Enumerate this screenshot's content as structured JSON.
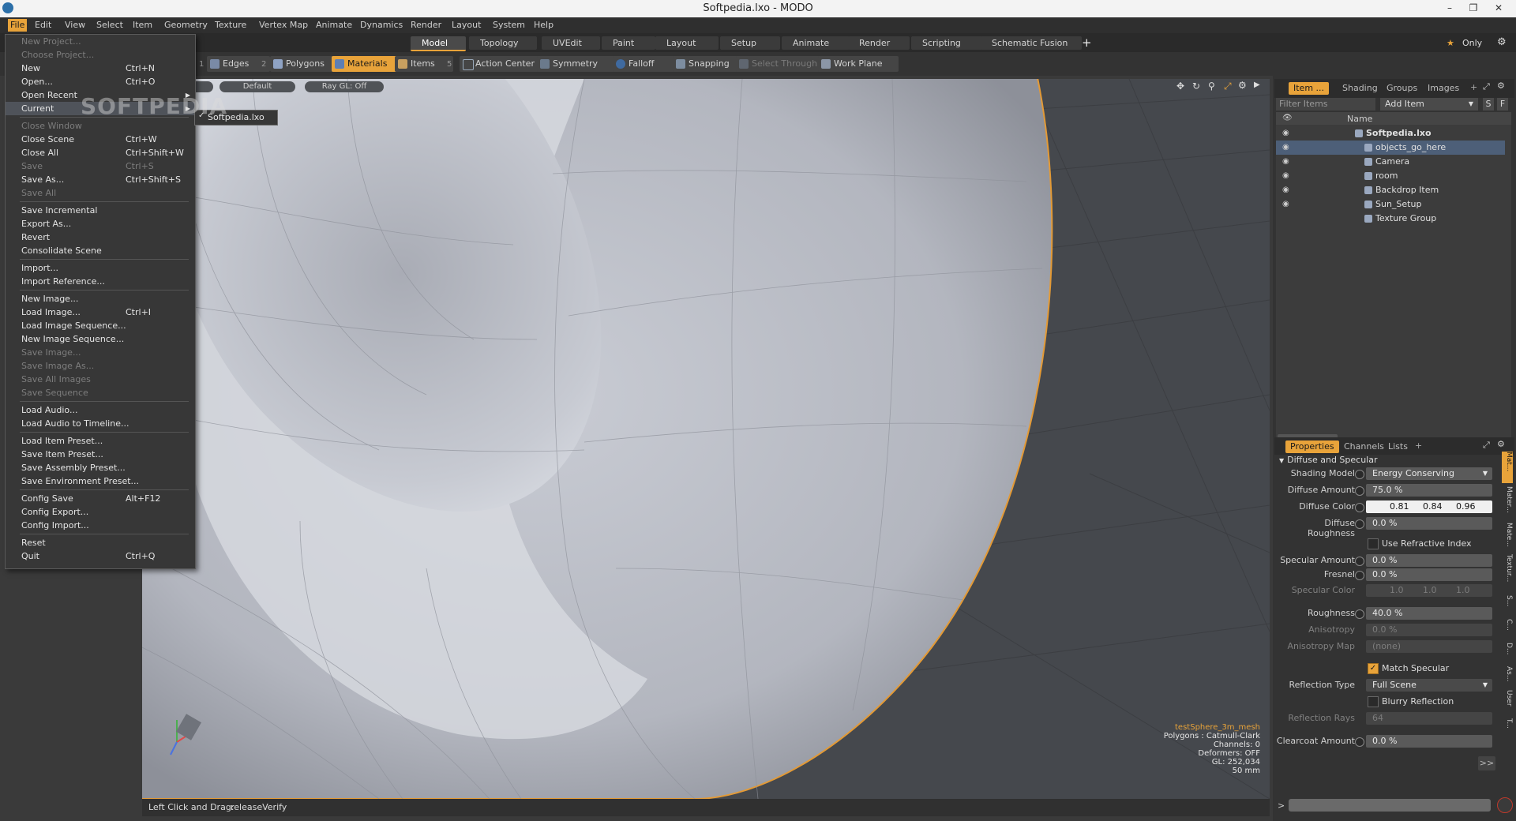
{
  "window": {
    "title": "Softpedia.lxo - MODO"
  },
  "menubar": [
    "File",
    "Edit",
    "View",
    "Select",
    "Item",
    "Geometry",
    "Texture",
    "Vertex Map",
    "Animate",
    "Dynamics",
    "Render",
    "Layout",
    "System",
    "Help"
  ],
  "layout_tabs": [
    "Model",
    "Topology",
    "UVEdit",
    "Paint",
    "Layout",
    "Setup",
    "Animate",
    "Render",
    "Scripting",
    "Schematic Fusion"
  ],
  "only_label": "Only",
  "toolbar": {
    "edges": "Edges",
    "polygons": "Polygons",
    "materials": "Materials",
    "items": "Items",
    "num1": "1",
    "num2": "2",
    "num5": "5",
    "action_center": "Action Center",
    "symmetry": "Symmetry",
    "falloff": "Falloff",
    "snapping": "Snapping",
    "select_through": "Select Through",
    "work_plane": "Work Plane"
  },
  "viewport": {
    "chip1": "ive",
    "chip2": "Default",
    "chip3": "Ray GL: Off",
    "hud": {
      "mesh": "testSphere_3m_mesh",
      "polygons": "Polygons : Catmull-Clark",
      "channels": "Channels: 0",
      "deformers": "Deformers: OFF",
      "gl": "GL: 252,034",
      "mm": "50 mm"
    },
    "status_action": "Left Click and Drag:",
    "status_value": "releaseVerify"
  },
  "file_menu": {
    "items": [
      {
        "label": "New Project...",
        "shortcut": "",
        "disabled": true
      },
      {
        "label": "Choose Project...",
        "shortcut": "",
        "disabled": true
      },
      {
        "label": "New",
        "shortcut": "Ctrl+N",
        "disabled": false
      },
      {
        "label": "Open...",
        "shortcut": "Ctrl+O",
        "disabled": false
      },
      {
        "label": "Open Recent",
        "shortcut": "",
        "disabled": false
      },
      {
        "label": "Current",
        "shortcut": "",
        "disabled": false
      },
      {
        "label": "Close Window",
        "shortcut": "",
        "disabled": true
      },
      {
        "label": "Close Scene",
        "shortcut": "Ctrl+W",
        "disabled": false
      },
      {
        "label": "Close All",
        "shortcut": "Ctrl+Shift+W",
        "disabled": false
      },
      {
        "label": "Save",
        "shortcut": "Ctrl+S",
        "disabled": true
      },
      {
        "label": "Save As...",
        "shortcut": "Ctrl+Shift+S",
        "disabled": false
      },
      {
        "label": "Save All",
        "shortcut": "",
        "disabled": true
      },
      {
        "label": "Save Incremental",
        "shortcut": "",
        "disabled": false
      },
      {
        "label": "Export As...",
        "shortcut": "",
        "disabled": false
      },
      {
        "label": "Revert",
        "shortcut": "",
        "disabled": false
      },
      {
        "label": "Consolidate Scene",
        "shortcut": "",
        "disabled": false
      },
      {
        "label": "Import...",
        "shortcut": "",
        "disabled": false
      },
      {
        "label": "Import Reference...",
        "shortcut": "",
        "disabled": false
      },
      {
        "label": "New Image...",
        "shortcut": "",
        "disabled": false
      },
      {
        "label": "Load Image...",
        "shortcut": "Ctrl+I",
        "disabled": false
      },
      {
        "label": "Load Image Sequence...",
        "shortcut": "",
        "disabled": false
      },
      {
        "label": "New Image Sequence...",
        "shortcut": "",
        "disabled": false
      },
      {
        "label": "Save Image...",
        "shortcut": "",
        "disabled": true
      },
      {
        "label": "Save Image As...",
        "shortcut": "",
        "disabled": true
      },
      {
        "label": "Save All Images",
        "shortcut": "",
        "disabled": true
      },
      {
        "label": "Save Sequence",
        "shortcut": "",
        "disabled": true
      },
      {
        "label": "Load Audio...",
        "shortcut": "",
        "disabled": false
      },
      {
        "label": "Load Audio to Timeline...",
        "shortcut": "",
        "disabled": false
      },
      {
        "label": "Load Item Preset...",
        "shortcut": "",
        "disabled": false
      },
      {
        "label": "Save Item Preset...",
        "shortcut": "",
        "disabled": false
      },
      {
        "label": "Save Assembly Preset...",
        "shortcut": "",
        "disabled": false
      },
      {
        "label": "Save Environment Preset...",
        "shortcut": "",
        "disabled": false
      },
      {
        "label": "Config Save",
        "shortcut": "Alt+F12",
        "disabled": false
      },
      {
        "label": "Config Export...",
        "shortcut": "",
        "disabled": false
      },
      {
        "label": "Config Import...",
        "shortcut": "",
        "disabled": false
      },
      {
        "label": "Reset",
        "shortcut": "",
        "disabled": false
      },
      {
        "label": "Quit",
        "shortcut": "Ctrl+Q",
        "disabled": false
      }
    ],
    "submenu_item": "Softpedia.lxo",
    "watermark": "SOFTPEDIA"
  },
  "items_panel": {
    "tabs": [
      "Item ...",
      "Shading",
      "Groups",
      "Images"
    ],
    "filter_placeholder": "Filter Items",
    "add_item": "Add Item",
    "btn_s": "S",
    "btn_f": "F",
    "col_name": "Name",
    "tree": [
      {
        "label": "Softpedia.lxo",
        "depth": 0,
        "bold": true,
        "selected": false
      },
      {
        "label": "objects_go_here",
        "depth": 1,
        "bold": false,
        "selected": true
      },
      {
        "label": "Camera",
        "depth": 1,
        "bold": false,
        "selected": false
      },
      {
        "label": "room",
        "depth": 1,
        "bold": false,
        "selected": false
      },
      {
        "label": "Backdrop Item",
        "depth": 1,
        "bold": false,
        "selected": false
      },
      {
        "label": "Sun_Setup",
        "depth": 1,
        "bold": false,
        "selected": false
      },
      {
        "label": "Texture Group",
        "depth": 1,
        "bold": false,
        "selected": false
      }
    ]
  },
  "properties_panel": {
    "tabs": [
      "Properties",
      "Channels",
      "Lists"
    ],
    "section": "Diffuse and Specular",
    "shading_model_label": "Shading Model",
    "shading_model": "Energy Conserving",
    "diffuse_amount_label": "Diffuse Amount",
    "diffuse_amount": "75.0 %",
    "diffuse_color_label": "Diffuse Color",
    "diffuse_color": [
      "0.81",
      "0.84",
      "0.96"
    ],
    "diffuse_roughness_label": "Diffuse Roughness",
    "diffuse_roughness": "0.0 %",
    "use_refractive_label": "Use Refractive Index",
    "specular_amount_label": "Specular Amount",
    "specular_amount": "0.0 %",
    "fresnel_label": "Fresnel",
    "fresnel": "0.0 %",
    "specular_color_label": "Specular Color",
    "specular_color": [
      "1.0",
      "1.0",
      "1.0"
    ],
    "roughness_label": "Roughness",
    "roughness": "40.0 %",
    "anisotropy_label": "Anisotropy",
    "anisotropy": "0.0 %",
    "anisotropy_map_label": "Anisotropy Map",
    "anisotropy_map": "(none)",
    "match_specular_label": "Match Specular",
    "reflection_type_label": "Reflection Type",
    "reflection_type": "Full Scene",
    "blurry_reflection_label": "Blurry Reflection",
    "reflection_rays_label": "Reflection Rays",
    "reflection_rays": "64",
    "clearcoat_label": "Clearcoat Amount",
    "clearcoat": "0.0 %",
    "side_tabs": [
      "Mat...",
      "Mater...",
      "Mate...",
      "Textur...",
      "S...",
      "C...",
      "D...",
      "As...",
      "User",
      "T..."
    ],
    "more": ">>"
  },
  "colors": {
    "accent": "#e8a33a",
    "select": "#4d5f78"
  }
}
